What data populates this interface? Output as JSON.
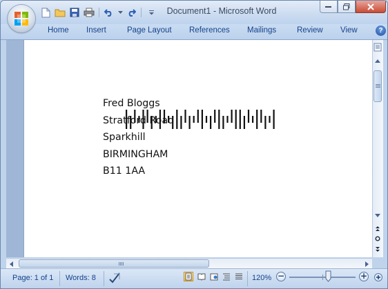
{
  "window": {
    "title": "Document1 - Microsoft Word"
  },
  "office_button": {
    "icon": "office-logo-icon"
  },
  "quick_access": {
    "items": [
      "new-document-icon",
      "open-folder-icon",
      "save-icon",
      "print-icon",
      "undo-icon",
      "undo-dropdown-icon",
      "redo-icon",
      "customize-toolbar-icon"
    ]
  },
  "ribbon": {
    "tabs": [
      "Home",
      "Insert",
      "Page Layout",
      "References",
      "Mailings",
      "Review",
      "View"
    ],
    "help_label": "?"
  },
  "document": {
    "barcode_icon": "postal-barcode",
    "address_lines": [
      "Fred Bloggs",
      "Stratford Road",
      "Sparkhill",
      "BIRMINGHAM",
      "B11 1AA"
    ]
  },
  "status_bar": {
    "page": "Page: 1 of 1",
    "words": "Words: 8",
    "zoom": "120%",
    "zoom_minus": "−",
    "zoom_plus": "+",
    "zoom_level_fraction": 0.58
  },
  "colors": {
    "ribbon_text": "#15428b",
    "frame": "#bfd3eb",
    "page": "#ffffff"
  }
}
